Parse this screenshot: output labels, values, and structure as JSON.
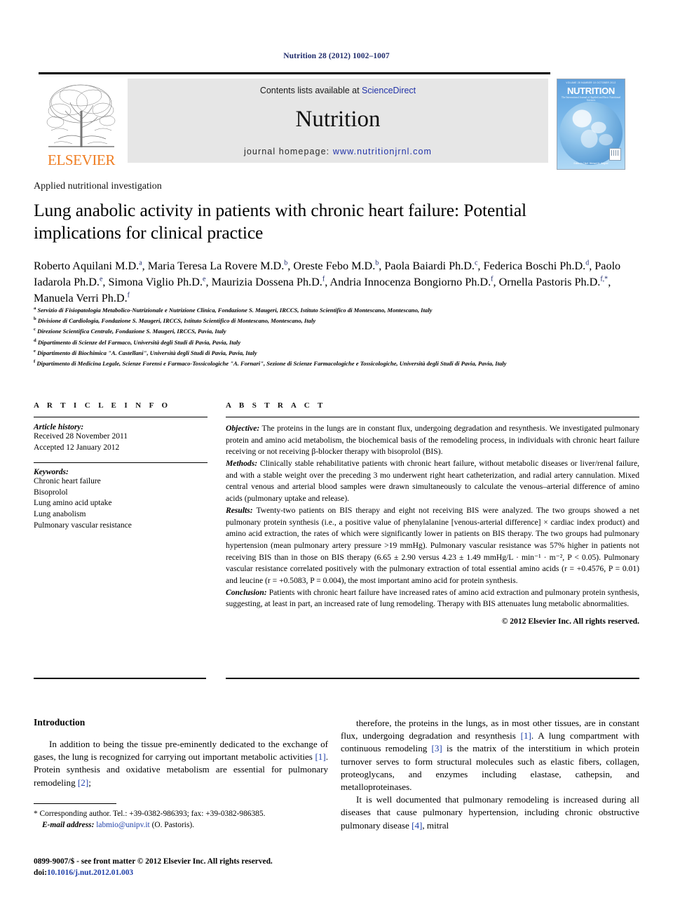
{
  "running_head": "Nutrition 28 (2012) 1002–1007",
  "header": {
    "publisher_name": "ELSEVIER",
    "contents_prefix": "Contents lists available at ",
    "contents_link": "ScienceDirect",
    "journal_title": "Nutrition",
    "homepage_prefix": "journal homepage: ",
    "homepage_url": "www.nutritionjrnl.com",
    "cover": {
      "top_line": "VOLUME 28  NUMBER 10  OCTOBER 2012",
      "title": "NUTRITION",
      "subtitle": "The International Journal of Applied and Basic Nutritional Sciences",
      "footer": "Editor-in-Chief: Michael M. Meguid"
    },
    "link_color": "#2233a8",
    "elsevier_orange": "#ef7d22",
    "band_background": "#e6e6e6"
  },
  "article": {
    "section_label": "Applied nutritional investigation",
    "title": "Lung anabolic activity in patients with chronic heart failure: Potential implications for clinical practice",
    "authors": [
      {
        "name": "Roberto Aquilani M.D.",
        "sup": "a",
        "sep": ", "
      },
      {
        "name": "Maria Teresa La Rovere M.D.",
        "sup": "b",
        "sep": ", "
      },
      {
        "name": "Oreste Febo M.D.",
        "sup": "b",
        "sep": ", "
      },
      {
        "name": "Paola Baiardi Ph.D.",
        "sup": "c",
        "sep": ", "
      },
      {
        "name": "Federica Boschi Ph.D.",
        "sup": "d",
        "sep": ", "
      },
      {
        "name": "Paolo Iadarola Ph.D.",
        "sup": "e",
        "sep": ", "
      },
      {
        "name": "Simona Viglio Ph.D.",
        "sup": "e",
        "sep": ", "
      },
      {
        "name": "Maurizia Dossena Ph.D.",
        "sup": "f",
        "sep": ", "
      },
      {
        "name": "Andria Innocenza Bongiorno Ph.D.",
        "sup": "f",
        "sep": ", "
      },
      {
        "name": "Ornella Pastoris Ph.D.",
        "sup": "f,*",
        "sep": ", "
      },
      {
        "name": "Manuela Verri Ph.D.",
        "sup": "f",
        "sep": ""
      }
    ],
    "affiliations": [
      {
        "marker": "a",
        "text": "Servizio di Fisiopatologia Metabolico-Nutrizionale e Nutrizione Clinica, Fondazione S. Maugeri, IRCCS, Istituto Scientifico di Montescano, Montescano, Italy"
      },
      {
        "marker": "b",
        "text": "Divisione di Cardiologia, Fondazione S. Maugeri, IRCCS, Istituto Scientifico di Montescano, Montescano, Italy"
      },
      {
        "marker": "c",
        "text": "Direzione Scientifica Centrale, Fondazione S. Maugeri, IRCCS, Pavia, Italy"
      },
      {
        "marker": "d",
        "text": "Dipartimento di Scienze del Farmaco, Università degli Studi di Pavia, Pavia, Italy"
      },
      {
        "marker": "e",
        "text": "Dipartimento di Biochimica \"A. Castellani\", Università degli Studi di Pavia, Pavia, Italy"
      },
      {
        "marker": "f",
        "text": "Dipartimento di Medicina Legale, Scienze Forensi e Farmaco-Tossicologiche \"A. Fornari\", Sezione di Scienze Farmacologiche e Tossicologiche, Università degli Studi di Pavia, Pavia, Italy"
      }
    ]
  },
  "article_info": {
    "heading": "A R T I C L E  I N F O",
    "history_label": "Article history:",
    "history": [
      "Received 28 November 2011",
      "Accepted 12 January 2012"
    ],
    "keywords_label": "Keywords:",
    "keywords": [
      "Chronic heart failure",
      "Bisoprolol",
      "Lung amino acid uptake",
      "Lung anabolism",
      "Pulmonary vascular resistance"
    ]
  },
  "abstract": {
    "heading": "A B S T R A C T",
    "sections": [
      {
        "lead": "Objective:",
        "body": " The proteins in the lungs are in constant flux, undergoing degradation and resynthesis. We investigated pulmonary protein and amino acid metabolism, the biochemical basis of the remodeling process, in individuals with chronic heart failure receiving or not receiving β-blocker therapy with bisoprolol (BIS)."
      },
      {
        "lead": "Methods:",
        "body": " Clinically stable rehabilitative patients with chronic heart failure, without metabolic diseases or liver/renal failure, and with a stable weight over the preceding 3 mo underwent right heart catheterization, and radial artery cannulation. Mixed central venous and arterial blood samples were drawn simultaneously to calculate the venous–arterial difference of amino acids (pulmonary uptake and release)."
      },
      {
        "lead": "Results:",
        "body": " Twenty-two patients on BIS therapy and eight not receiving BIS were analyzed. The two groups showed a net pulmonary protein synthesis (i.e., a positive value of phenylalanine [venous-arterial difference] × cardiac index product) and amino acid extraction, the rates of which were significantly lower in patients on BIS therapy. The two groups had pulmonary hypertension (mean pulmonary artery pressure >19 mmHg). Pulmonary vascular resistance was 57% higher in patients not receiving BIS than in those on BIS therapy (6.65 ± 2.90 versus 4.23 ± 1.49 mmHg/L · min⁻¹ · m⁻², P < 0.05). Pulmonary vascular resistance correlated positively with the pulmonary extraction of total essential amino acids (r = +0.4576, P = 0.01) and leucine (r = +0.5083, P = 0.004), the most important amino acid for protein synthesis."
      },
      {
        "lead": "Conclusion:",
        "body": " Patients with chronic heart failure have increased rates of amino acid extraction and pulmonary protein synthesis, suggesting, at least in part, an increased rate of lung remodeling. Therapy with BIS attenuates lung metabolic abnormalities."
      }
    ],
    "copyright": "© 2012 Elsevier Inc. All rights reserved."
  },
  "body": {
    "intro_heading": "Introduction",
    "left_paragraphs": [
      "In addition to being the tissue pre-eminently dedicated to the exchange of gases, the lung is recognized for carrying out important metabolic activities [1]. Protein synthesis and oxidative metabolism are essential for pulmonary remodeling [2];"
    ],
    "right_paragraphs": [
      "therefore, the proteins in the lungs, as in most other tissues, are in constant flux, undergoing degradation and resynthesis [1]. A lung compartment with continuous remodeling [3] is the matrix of the interstitium in which protein turnover serves to form structural molecules such as elastic fibers, collagen, proteoglycans, and enzymes including elastase, cathepsin, and metalloproteinases.",
      "It is well documented that pulmonary remodeling is increased during all diseases that cause pulmonary hypertension, including chronic obstructive pulmonary disease [4], mitral"
    ]
  },
  "footnote": {
    "corresponding": "* Corresponding author. Tel.: +39-0382-986393; fax: +39-0382-986385.",
    "email_label": "E-mail address:",
    "email": "labmio@unipv.it",
    "email_owner": "(O. Pastoris).",
    "imprint": "0899-9007/$ - see front matter © 2012 Elsevier Inc. All rights reserved.",
    "doi_label": "doi:",
    "doi": "10.1016/j.nut.2012.01.003"
  }
}
